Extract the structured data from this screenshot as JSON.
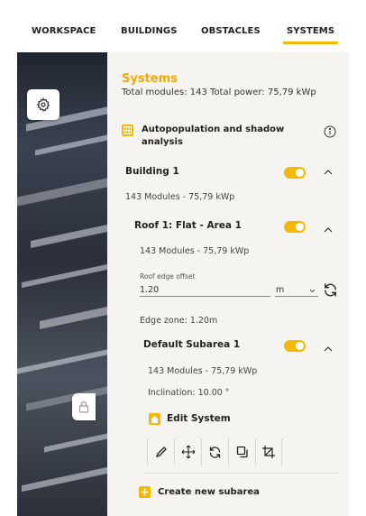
{
  "tabs": [
    {
      "label": "WORKSPACE"
    },
    {
      "label": "BUILDINGS"
    },
    {
      "label": "OBSTACLES"
    },
    {
      "label": "SYSTEMS",
      "active": true
    }
  ],
  "panel": {
    "title": "Systems",
    "summary": "Total modules: 143 Total power: 75,79 kWp",
    "autopopulation": {
      "line1": "Autopopulation and shadow",
      "line2": "analysis"
    },
    "building": {
      "name": "Building 1",
      "stats": "143 Modules - 75,79 kWp",
      "enabled": true
    },
    "roof": {
      "name": "Roof 1: Flat - Area 1",
      "stats": "143 Modules - 75,79 kWp",
      "enabled": true,
      "edge_offset_label": "Roof edge offset",
      "edge_offset_value": "1.20",
      "unit": "m",
      "edge_zone": "Edge zone: 1.20m"
    },
    "subarea": {
      "name": "Default Subarea 1",
      "stats": "143 Modules - 75,79 kWp",
      "inclination": "Inclination: 10.00 °",
      "enabled": true,
      "edit_label": "Edit System"
    },
    "create_subarea_label": "Create new subarea"
  },
  "colors": {
    "accent": "#f5b800",
    "title": "#f2a900",
    "panel_bg": "#f6f4f1"
  },
  "icons": [
    "settings-gear-icon",
    "lock-icon",
    "grid-icon",
    "info-icon",
    "chevron-up-icon",
    "chevron-down-icon",
    "refresh-icon",
    "house-icon",
    "pencil-icon",
    "move-icon",
    "rotate-icon",
    "copy-icon",
    "crop-icon",
    "plus-icon"
  ]
}
